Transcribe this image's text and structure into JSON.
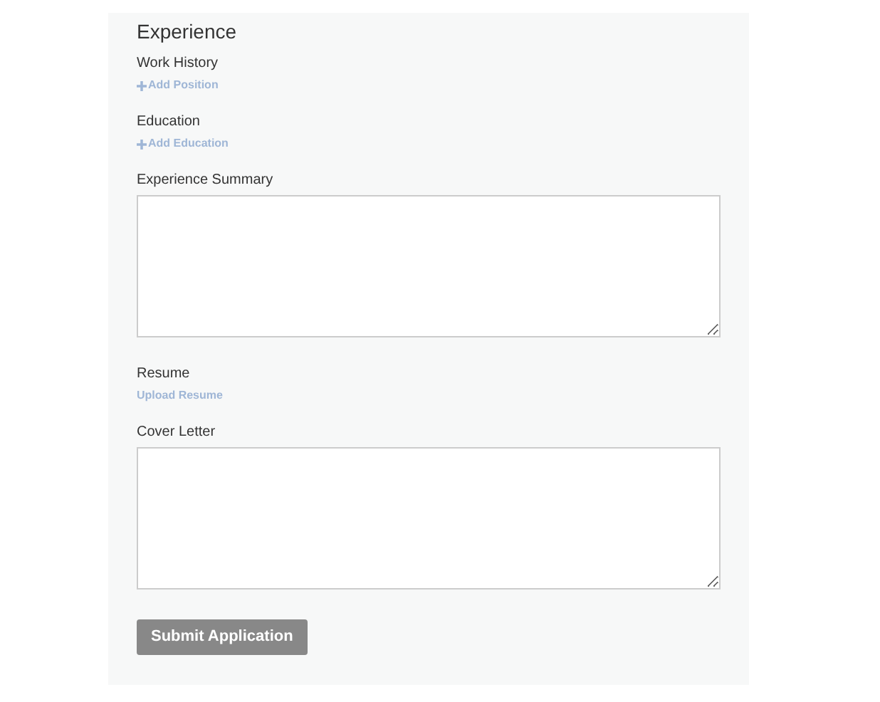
{
  "section": {
    "title": "Experience"
  },
  "fields": [
    {
      "kind": "link",
      "label": "Work History",
      "action": "Add Position",
      "plus": true
    },
    {
      "kind": "link",
      "label": "Education",
      "action": "Add Education",
      "plus": true
    },
    {
      "kind": "textarea",
      "label": "Experience Summary"
    },
    {
      "kind": "link",
      "label": "Resume",
      "action": "Upload Resume",
      "plus": false
    },
    {
      "kind": "textarea",
      "label": "Cover Letter"
    }
  ],
  "submit": {
    "label": "Submit Application"
  }
}
